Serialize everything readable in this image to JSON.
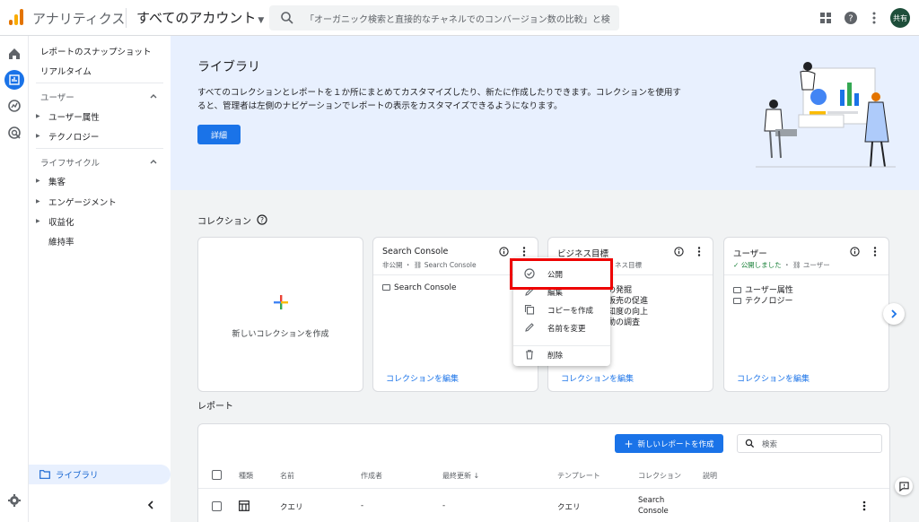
{
  "header": {
    "app_title": "アナリティクス",
    "account_label": "すべてのアカウント",
    "search_placeholder": "「オーガニック検索と直接的なチャネルでのコンバージョン数の比較」と検…",
    "avatar_text": "共有"
  },
  "sidenav": {
    "snapshot": "レポートのスナップショット",
    "realtime": "リアルタイム",
    "user_section": "ユーザー",
    "user_attr": "ユーザー属性",
    "tech": "テクノロジー",
    "lifecycle_section": "ライフサイクル",
    "acquisition": "集客",
    "engagement": "エンゲージメント",
    "monetization": "収益化",
    "retention": "維持率",
    "library": "ライブラリ"
  },
  "hero": {
    "title": "ライブラリ",
    "description": "すべてのコレクションとレポートを１か所にまとめてカスタマイズしたり、新たに作成したりできます。コレクションを使用すると、管理者は左側のナビゲーションでレポートの表示をカスタマイズできるようになります。",
    "details_button": "詳細"
  },
  "collections": {
    "title": "コレクション",
    "new_collection": "新しいコレクションを作成",
    "edit_label": "コレクションを編集",
    "cards": [
      {
        "title": "Search Console",
        "status": "非公開",
        "sub": "Search Console",
        "items": [
          "Search Console"
        ]
      },
      {
        "title": "ビジネス目標",
        "sub": "ネス目標",
        "items": [
          "の発掘",
          "販売の促進",
          "知度の向上",
          "動の調査"
        ]
      },
      {
        "title": "ユーザー",
        "status": "公開しました",
        "sub": "ユーザー",
        "items": [
          "ユーザー属性",
          "テクノロジー"
        ]
      }
    ]
  },
  "menu": {
    "publish": "公開",
    "edit": "編集",
    "copy": "コピーを作成",
    "rename": "名前を変更",
    "delete": "削除"
  },
  "reports": {
    "title": "レポート",
    "new_report": "新しいレポートを作成",
    "search_placeholder": "検索",
    "columns": [
      "種類",
      "名前",
      "作成者",
      "最終更新",
      "テンプレート",
      "コレクション",
      "説明"
    ],
    "rows": [
      {
        "name": "クエリ",
        "creator": "-",
        "updated": "-",
        "template": "クエリ",
        "collection_1": "Search",
        "collection_2": "Console"
      }
    ]
  },
  "colors": {
    "primary": "#1a73e8",
    "hero_bg": "#e8f0fe",
    "highlight": "#e00000"
  }
}
